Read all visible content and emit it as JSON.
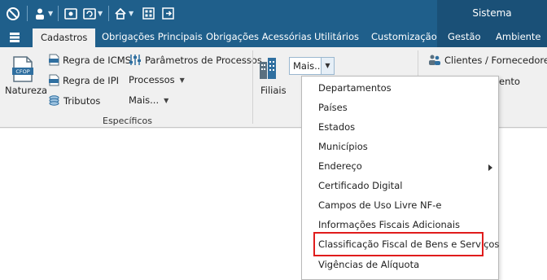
{
  "title_bar": {
    "system_label": "Sistema"
  },
  "tabs": [
    {
      "label": "Cadastros"
    },
    {
      "label": "Obrigações Principais"
    },
    {
      "label": "Obrigações Acessórias"
    },
    {
      "label": "Utilitários"
    },
    {
      "label": "Customização"
    },
    {
      "label": "Gestão"
    },
    {
      "label": "Ambiente"
    }
  ],
  "ribbon": {
    "natureza": {
      "label": "Natureza",
      "icon_text": "CFOP"
    },
    "regra_icms": {
      "label": "Regra de ICMS",
      "icon_text": "ICMS"
    },
    "regra_ipi": {
      "label": "Regra de IPI",
      "icon_text": "IPI"
    },
    "tributos": {
      "label": "Tributos"
    },
    "parametros": {
      "label": "Parâmetros de Processos"
    },
    "processos": {
      "label": "Processos"
    },
    "mais_small": {
      "label": "Mais..."
    },
    "group_label": "Específicos",
    "filiais": {
      "label": "Filiais"
    },
    "mais_combo": {
      "label": "Mais..."
    },
    "clientes": {
      "label": "Clientes / Fornecedores"
    },
    "partial_item": {
      "label": "ento"
    }
  },
  "dropdown": {
    "items": [
      {
        "label": "Departamentos"
      },
      {
        "label": "Países"
      },
      {
        "label": "Estados"
      },
      {
        "label": "Municípios"
      },
      {
        "label": "Endereço"
      },
      {
        "label": "Certificado Digital"
      },
      {
        "label": "Campos de Uso Livre NF-e"
      },
      {
        "label": "Informações Fiscais Adicionais"
      },
      {
        "label": "Classificação Fiscal de Bens e Serviços"
      },
      {
        "label": "Vigências de Alíquota"
      }
    ]
  },
  "colors": {
    "ribbon_blue": "#1f5f8b",
    "highlight_red": "#e01c1c"
  }
}
